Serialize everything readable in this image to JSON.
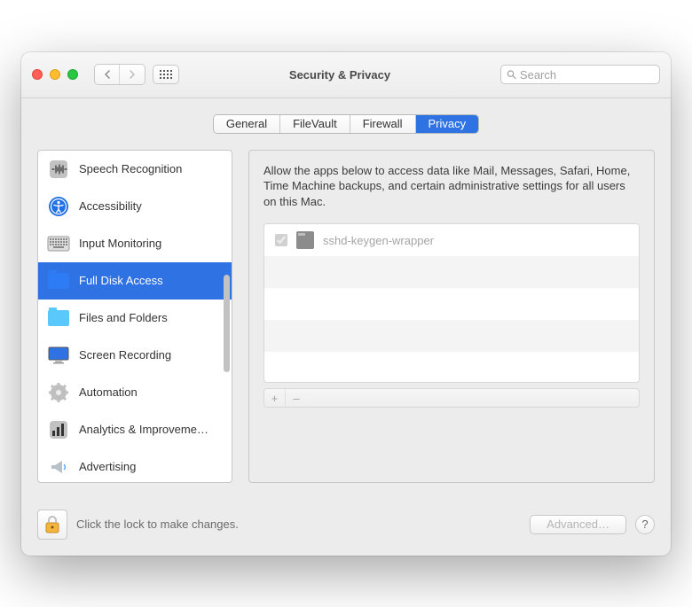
{
  "window": {
    "title": "Security & Privacy",
    "search_placeholder": "Search"
  },
  "tabs": [
    {
      "label": "General",
      "active": false
    },
    {
      "label": "FileVault",
      "active": false
    },
    {
      "label": "Firewall",
      "active": false
    },
    {
      "label": "Privacy",
      "active": true
    }
  ],
  "sidebar": {
    "items": [
      {
        "id": "speech-recognition",
        "label": "Speech Recognition",
        "icon": "sound-wave",
        "selected": false
      },
      {
        "id": "accessibility",
        "label": "Accessibility",
        "icon": "accessibility",
        "selected": false
      },
      {
        "id": "input-monitoring",
        "label": "Input Monitoring",
        "icon": "keyboard",
        "selected": false
      },
      {
        "id": "full-disk-access",
        "label": "Full Disk Access",
        "icon": "folder-blue",
        "selected": true
      },
      {
        "id": "files-and-folders",
        "label": "Files and Folders",
        "icon": "folder-cyan",
        "selected": false
      },
      {
        "id": "screen-recording",
        "label": "Screen Recording",
        "icon": "monitor",
        "selected": false
      },
      {
        "id": "automation",
        "label": "Automation",
        "icon": "gear",
        "selected": false
      },
      {
        "id": "analytics-improvements",
        "label": "Analytics & Improveme…",
        "icon": "analytics",
        "selected": false
      },
      {
        "id": "advertising",
        "label": "Advertising",
        "icon": "megaphone",
        "selected": false
      }
    ]
  },
  "main": {
    "description": "Allow the apps below to access data like Mail, Messages, Safari, Home, Time Machine backups, and certain administrative settings for all users on this Mac.",
    "apps": [
      {
        "name": "sshd-keygen-wrapper",
        "checked": true,
        "enabled": false
      }
    ],
    "add_label": "+",
    "remove_label": "–"
  },
  "footer": {
    "lock_text": "Click the lock to make changes.",
    "advanced_label": "Advanced…",
    "help_label": "?"
  }
}
